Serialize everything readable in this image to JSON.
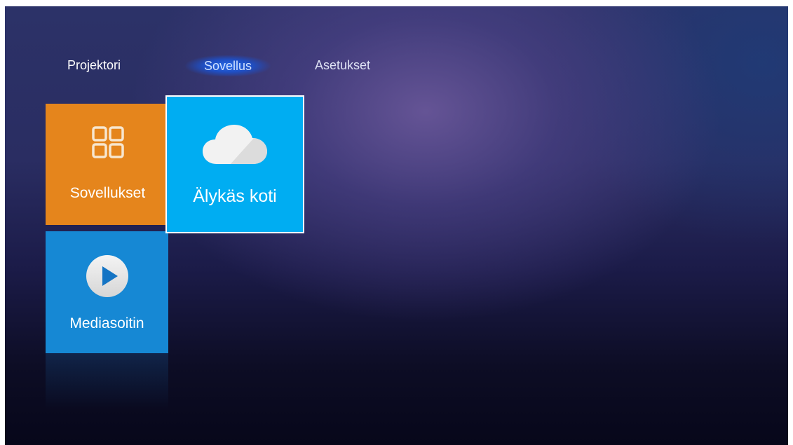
{
  "nav": {
    "tabs": [
      {
        "label": "Projektori",
        "selected": false
      },
      {
        "label": "Sovellus",
        "selected": true
      },
      {
        "label": "Asetukset",
        "selected": false
      }
    ]
  },
  "tiles": {
    "apps": {
      "label": "Sovellukset",
      "icon": "app-grid-icon",
      "color": "#e5851c"
    },
    "smart_home": {
      "label": "Älykäs koti",
      "icon": "cloud-icon",
      "color": "#00adf2",
      "focused": true
    },
    "media_player": {
      "label": "Mediasoitin",
      "icon": "play-icon",
      "color": "#1688d4"
    }
  }
}
